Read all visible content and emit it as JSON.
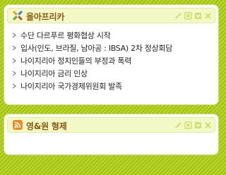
{
  "widgets": [
    {
      "title": "올아프리카",
      "icon": "puzzle-icon",
      "items": [
        {
          "text": "수단 다르푸르 평화협상 시작"
        },
        {
          "text": "입사(인도, 브라질, 남아공 : IBSA) 2차 정상회담"
        },
        {
          "text": "나이지리아 정치인들의 부정과 폭력"
        },
        {
          "text": "나이지리아 금리 인상"
        },
        {
          "text": "나이지리아 국가경제위원회 발족"
        }
      ]
    },
    {
      "title": "영&원 형제",
      "icon": "rss-icon",
      "items": []
    }
  ],
  "controls": [
    "edit-icon",
    "settings-icon",
    "minimize-icon",
    "close-icon"
  ],
  "colors": {
    "background_stripe_a": "#b9d62a",
    "background_stripe_b": "#a3c118",
    "titlebar": "#f3f8c7",
    "title_text": "#8a5a10",
    "control_icon": "#cfe06a",
    "rss_orange": "#f08a24"
  }
}
